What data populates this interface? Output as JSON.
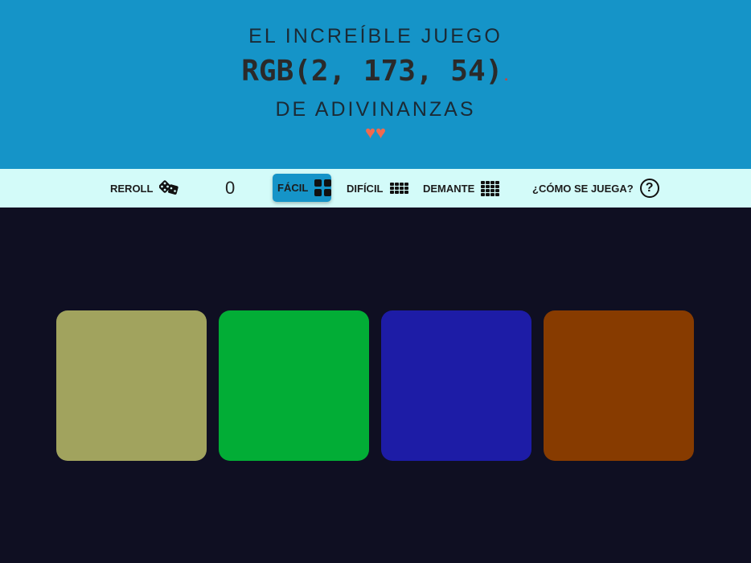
{
  "header": {
    "title_top": "EL INCREÍBLE JUEGO",
    "target_rgb": "RGB(2, 173, 54)",
    "dot": ".",
    "title_bottom": "DE ADIVINANZAS",
    "lives": "♥♥",
    "lives_count": 2
  },
  "toolbar": {
    "reroll_label": "REROLL",
    "score": "0",
    "easy_label": "FÁCIL",
    "hard_label": "DIFÍCIL",
    "insane_label": "DEMANTE",
    "help_label": "¿CÓMO SE JUEGA?",
    "help_glyph": "?",
    "active_mode": "FÁCIL"
  },
  "colors": {
    "header_bg": "#1594c8",
    "toolbar_bg": "#d3fbf9",
    "board_bg": "#0f0f22",
    "heart": "#f06a4f"
  },
  "squares": [
    {
      "color": "#a1a35e"
    },
    {
      "color": "#02ad36"
    },
    {
      "color": "#1d1ca6"
    },
    {
      "color": "#873b00"
    }
  ]
}
